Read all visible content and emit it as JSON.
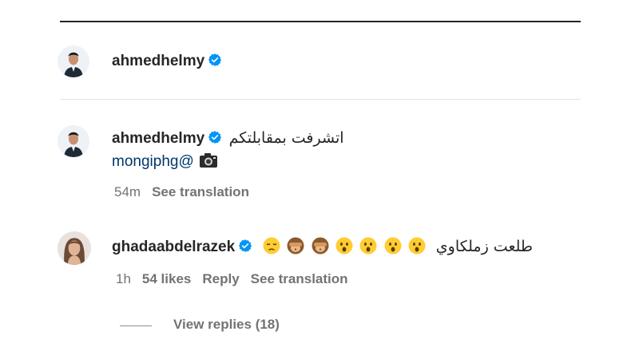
{
  "post_header": {
    "username": "ahmedhelmy",
    "verified": true
  },
  "comment1": {
    "username": "ahmedhelmy",
    "verified": true,
    "text": "اتشرفت بمقابلتكم",
    "mention": "mongiphg@",
    "emoji": "camera-icon",
    "time": "54m",
    "see_translation": "See translation"
  },
  "comment2": {
    "username": "ghadaabdelrazek",
    "verified": true,
    "emojis": [
      "pensive-face",
      "see-no-evil-monkey",
      "see-no-evil-monkey",
      "astonished-face",
      "astonished-face",
      "astonished-face",
      "astonished-face"
    ],
    "text": "طلعت زملكاوي",
    "time": "1h",
    "likes": "54 likes",
    "reply": "Reply",
    "see_translation": "See translation",
    "view_replies": "View replies (18)"
  },
  "colors": {
    "verified_blue": "#0095f6",
    "mention_blue": "#00376b",
    "meta_gray": "#737373",
    "text": "#262626"
  }
}
